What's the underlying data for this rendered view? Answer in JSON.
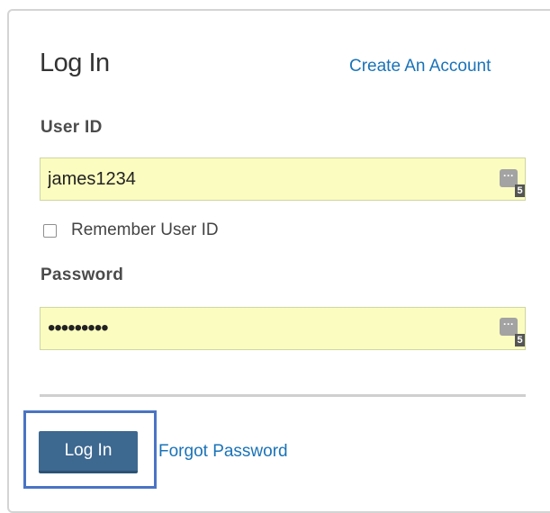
{
  "login_form": {
    "title": "Log In",
    "create_account_link": "Create An Account",
    "user_id": {
      "label": "User ID",
      "value": "james1234",
      "password_manager_badge": "5"
    },
    "remember_user_id": {
      "label": "Remember User ID",
      "checked": false
    },
    "password": {
      "label": "Password",
      "value": "•••••••••",
      "password_manager_badge": "5"
    },
    "login_button": "Log In",
    "forgot_password_link": "Forgot Password"
  },
  "icons": {
    "password_manager": "ellipsis-key-icon"
  },
  "colors": {
    "link": "#1a73b8",
    "button": "#3d6890",
    "input_autofill_bg": "#fbfcbf",
    "focus_ring": "#4a74c4"
  }
}
